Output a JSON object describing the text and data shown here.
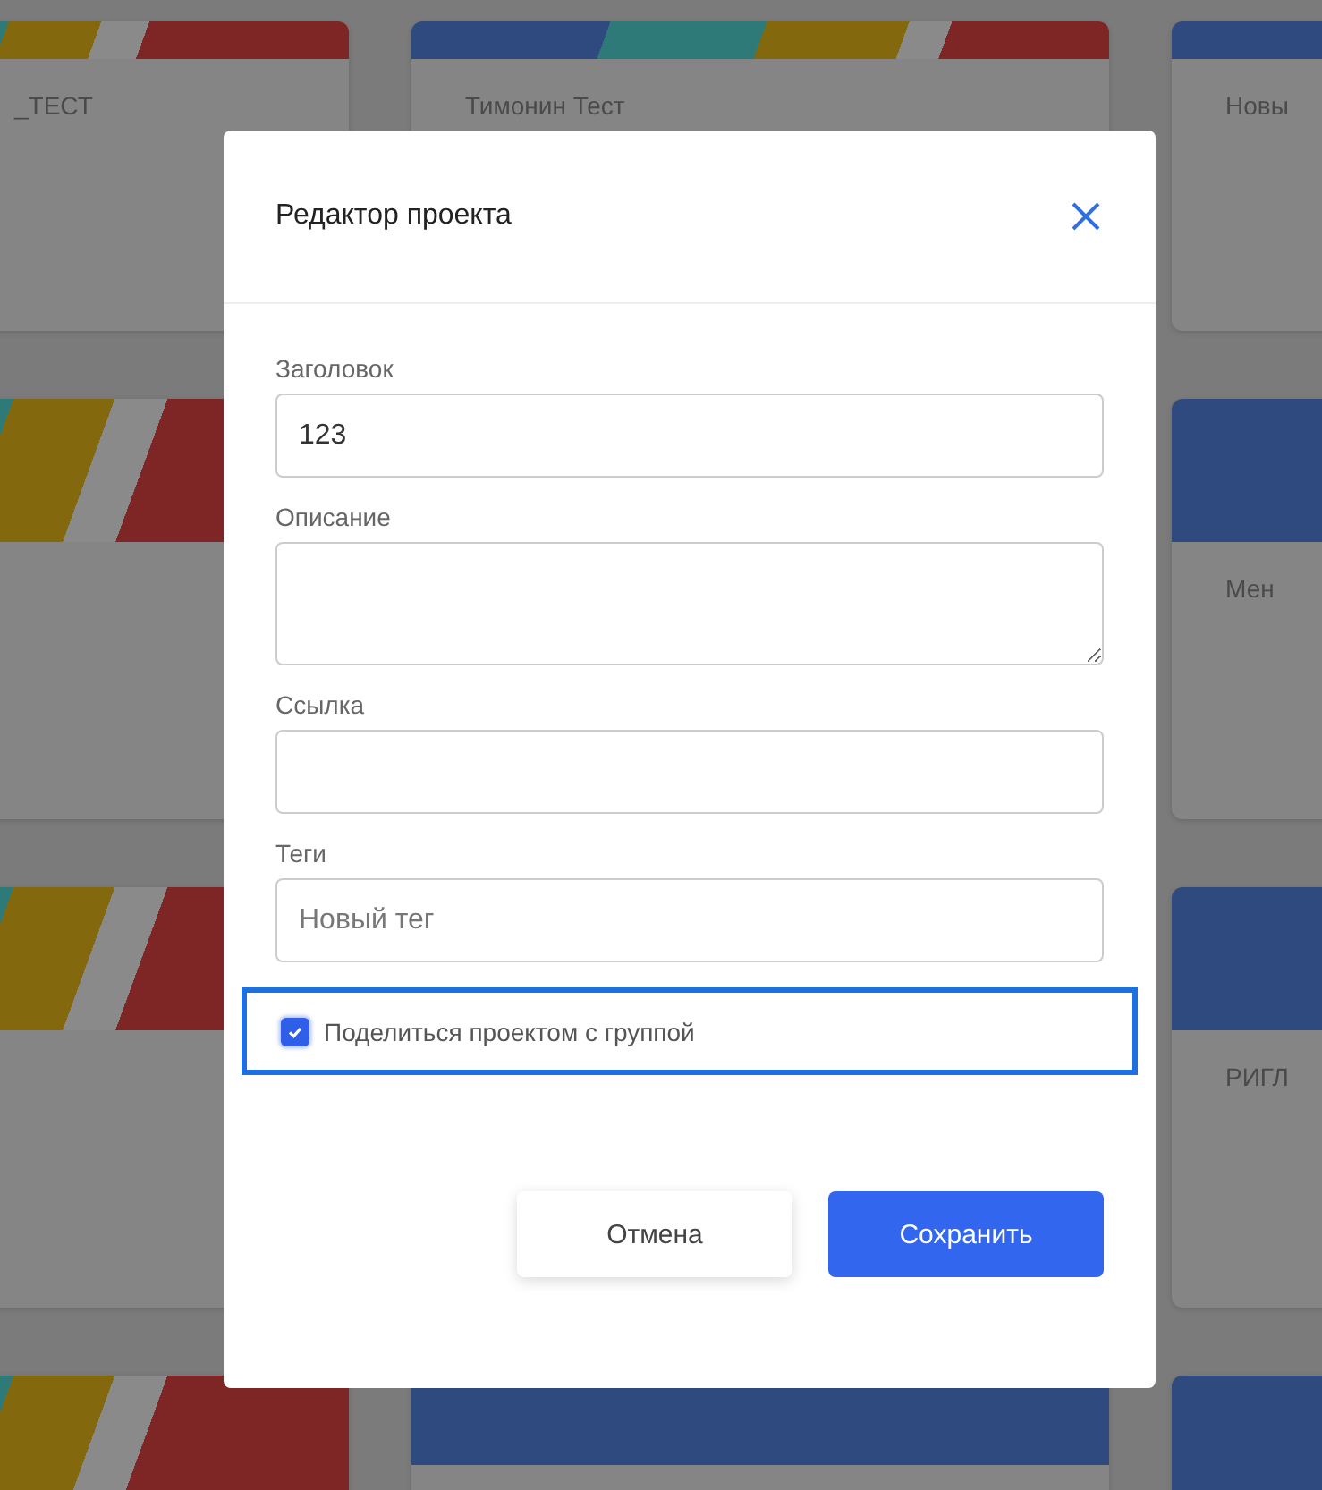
{
  "background_columns": [
    {
      "cards": [
        {
          "title": "_ТЕСТ",
          "kind": "striped"
        },
        {
          "kind": "striped"
        },
        {
          "kind": "striped"
        },
        {
          "kind": "striped"
        }
      ]
    },
    {
      "cards": [
        {
          "title": "Тимонин Тест",
          "kind": "striped"
        },
        {
          "kind": "blue"
        }
      ]
    },
    {
      "cards": [
        {
          "title": "Новы",
          "kind": "blue"
        },
        {
          "title": "Мен",
          "kind": "blue"
        },
        {
          "title": "РИГЛ",
          "kind": "blue"
        },
        {
          "kind": "blue"
        }
      ]
    }
  ],
  "dialog": {
    "title": "Редактор проекта",
    "fields": [
      {
        "label": "Заголовок",
        "kind": "input",
        "value": "123"
      },
      {
        "label": "Описание",
        "kind": "textarea"
      },
      {
        "label": "Ссылка",
        "kind": "input"
      },
      {
        "label": "Теги",
        "kind": "input",
        "placeholder": "Новый тег"
      }
    ],
    "share": {
      "label": "Поделиться проектом с группой",
      "checked": true,
      "focused": true
    },
    "buttons": [
      {
        "label": "Отмена",
        "kind": "secondary"
      },
      {
        "label": "Сохранить",
        "kind": "primary"
      }
    ]
  }
}
